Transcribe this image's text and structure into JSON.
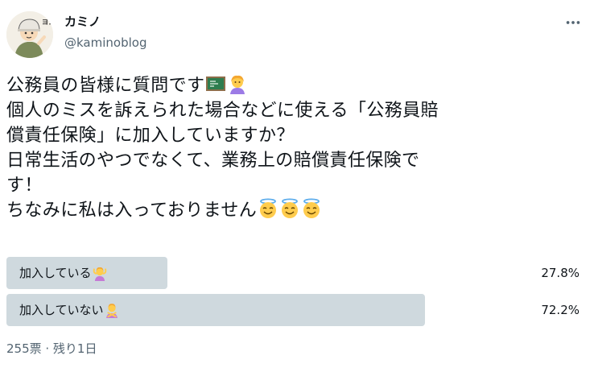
{
  "author": {
    "name": "カミノ",
    "handle": "@kaminoblog",
    "avatar_badge": "ヨシ!"
  },
  "tweet": {
    "lines": [
      "公務員の皆様に質問です",
      "個人のミスを訴えられた場合などに使える「公務員賠",
      "償責任保険」に加入していますか？",
      "日常生活のやつでなくて、業務上の賠償責任保険で",
      "す！",
      "ちなみに私は入っておりません"
    ],
    "line1_emojis": [
      "chalkboard-emoji",
      "teacher-emoji"
    ],
    "line6_emojis": [
      "halo-smile-emoji",
      "halo-smile-emoji",
      "halo-smile-emoji"
    ]
  },
  "poll": {
    "options": [
      {
        "label": "加入している",
        "percent_text": "27.8%",
        "fraction": 0.278,
        "emoji": "person-gesturing-ok-emoji"
      },
      {
        "label": "加入していない",
        "percent_text": "72.2%",
        "fraction": 0.722,
        "emoji": "person-gesturing-no-emoji"
      }
    ],
    "footer": "255票 · 残り1日"
  },
  "colors": {
    "poll_bar": "#cfd9de",
    "secondary_text": "#536471",
    "primary_text": "#0f1419"
  }
}
